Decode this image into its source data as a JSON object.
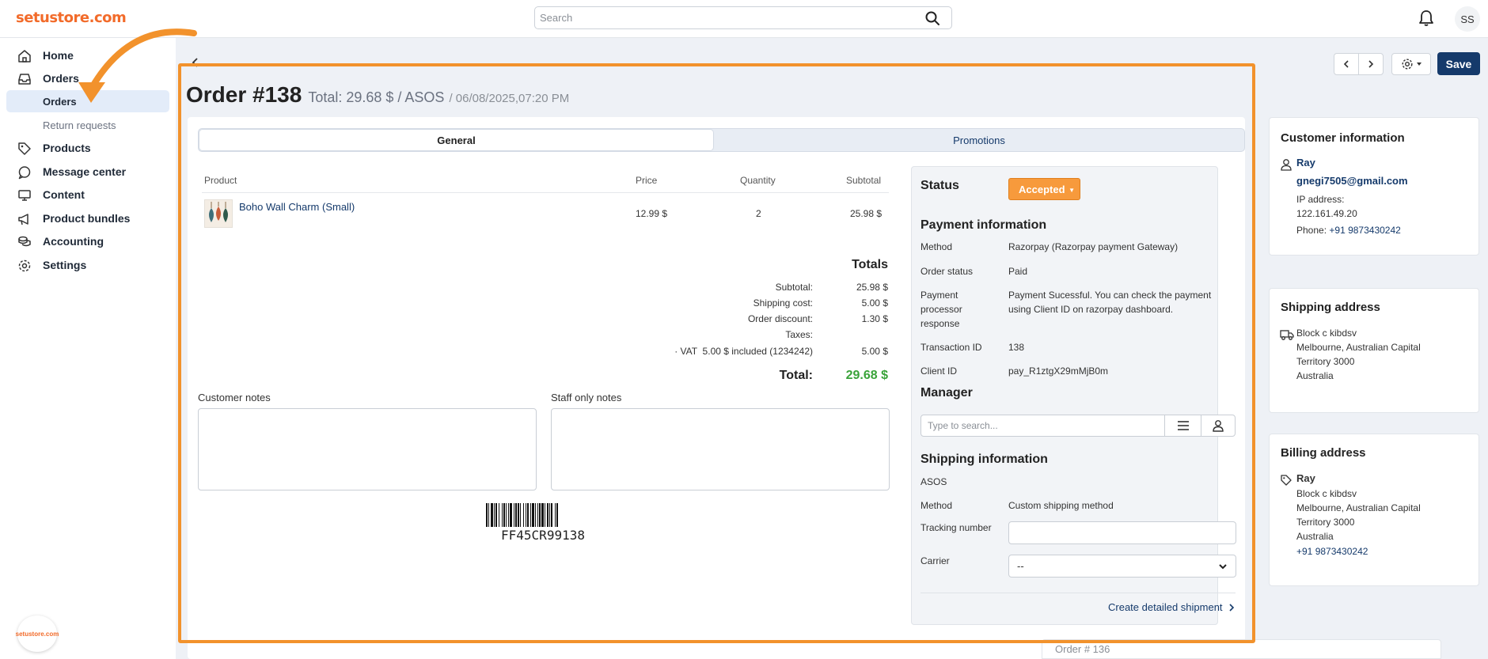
{
  "header": {
    "logo_text": "setustore.com",
    "search_placeholder": "Search",
    "avatar_initials": "SS"
  },
  "sidebar": {
    "items": [
      {
        "label": "Home",
        "icon": "home-icon"
      },
      {
        "label": "Orders",
        "icon": "inbox-icon"
      },
      {
        "label": "Orders",
        "sub": true,
        "active": true
      },
      {
        "label": "Return requests",
        "sub": true
      },
      {
        "label": "Products",
        "icon": "tag-icon"
      },
      {
        "label": "Message center",
        "icon": "chat-icon"
      },
      {
        "label": "Content",
        "icon": "monitor-icon"
      },
      {
        "label": "Product bundles",
        "icon": "megaphone-icon"
      },
      {
        "label": "Accounting",
        "icon": "coins-icon"
      },
      {
        "label": "Settings",
        "icon": "gear-icon"
      }
    ],
    "bottom_logo": "setustore.com"
  },
  "toolbar": {
    "save_label": "Save"
  },
  "order": {
    "title": "Order #138",
    "total_text": "Total: 29.68 $ / ASOS",
    "date_text": "/ 06/08/2025,07:20 PM"
  },
  "tabs": [
    "General",
    "Promotions"
  ],
  "products_table": {
    "headers": [
      "Product",
      "Price",
      "Quantity",
      "Subtotal"
    ],
    "rows": [
      {
        "product": "Boho Wall Charm (Small)",
        "price": "12.99 $",
        "quantity": "2",
        "subtotal": "25.98 $"
      }
    ]
  },
  "totals": {
    "title": "Totals",
    "rows": [
      {
        "label": "Subtotal:",
        "value": "25.98 $"
      },
      {
        "label": "Shipping cost:",
        "value": "5.00 $"
      },
      {
        "label": "Order discount:",
        "value": "1.30 $"
      },
      {
        "label": "Taxes:",
        "value": ""
      },
      {
        "label": "· VAT  5.00 $ included (1234242)",
        "value": "5.00 $"
      }
    ],
    "total_label": "Total:",
    "total_value": "29.68 $"
  },
  "notes": {
    "customer_label": "Customer notes",
    "staff_label": "Staff only notes"
  },
  "barcode": {
    "text": "FF45CR99138"
  },
  "status_panel": {
    "status_heading": "Status",
    "status_value": "Accepted",
    "payment_heading": "Payment information",
    "payment_rows": [
      {
        "key": "Method",
        "value": "Razorpay (Razorpay payment Gateway)"
      },
      {
        "key": "Order status",
        "value": "Paid"
      },
      {
        "key": "Payment processor response",
        "value": "Payment Sucessful. You can check the payment using Client ID on razorpay dashboard."
      },
      {
        "key": "Transaction ID",
        "value": "138"
      },
      {
        "key": "Client ID",
        "value": "pay_R1ztgX29mMjB0m"
      }
    ],
    "manager_heading": "Manager",
    "manager_placeholder": "Type to search...",
    "shipping_heading": "Shipping information",
    "shipping_company": "ASOS",
    "shipping_rows": [
      {
        "key": "Method",
        "value": "Custom shipping method"
      },
      {
        "key": "Tracking number",
        "value": ""
      },
      {
        "key": "Carrier",
        "value": "--"
      }
    ],
    "create_shipment": "Create detailed shipment"
  },
  "customer_info": {
    "heading": "Customer information",
    "name": "Ray",
    "email": "gnegi7505@gmail.com",
    "ip_label": "IP address:",
    "ip": "122.161.49.20",
    "phone_label": "Phone:",
    "phone": "+91 9873430242"
  },
  "shipping_address": {
    "heading": "Shipping address",
    "lines": [
      "Block c kibdsv",
      "Melbourne, Australian Capital",
      "Territory 3000",
      "Australia"
    ]
  },
  "billing_address": {
    "heading": "Billing address",
    "name": "Ray",
    "lines": [
      "Block c kibdsv",
      "Melbourne, Australian Capital",
      "Territory 3000",
      "Australia"
    ],
    "phone": "+91 9873430242"
  },
  "bottom_row": {
    "text": "Order # 136"
  },
  "colors": {
    "brand_orange": "#f26b2a",
    "highlight_orange": "#f2922c",
    "navy": "#153a6b",
    "accepted_orange": "#f79a3c",
    "total_green": "#3aa33a"
  }
}
